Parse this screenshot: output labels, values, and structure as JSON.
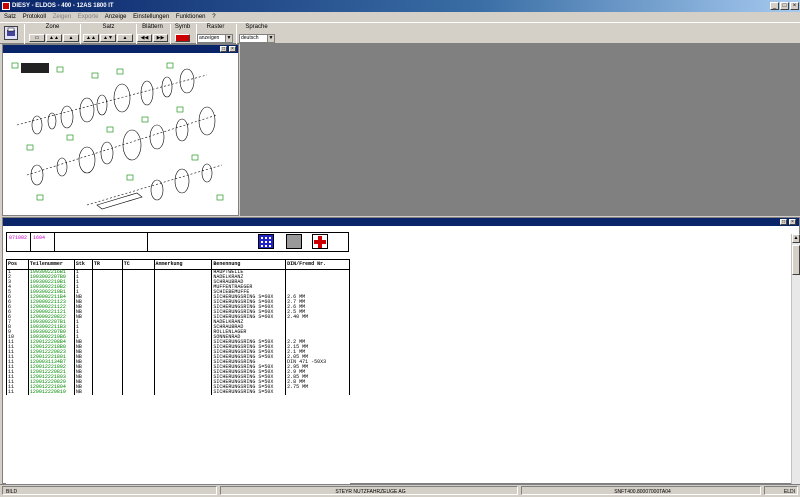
{
  "titlebar": {
    "title": "DIESY - ELDOS - 400 - 12AS 1800 IT"
  },
  "menu": [
    {
      "label": "Satz",
      "disabled": false
    },
    {
      "label": "Protokoll",
      "disabled": false
    },
    {
      "label": "Zeigen",
      "disabled": true
    },
    {
      "label": "Exporte",
      "disabled": true
    },
    {
      "label": "Anzeige",
      "disabled": false
    },
    {
      "label": "Einstellungen",
      "disabled": false
    },
    {
      "label": "Funktionen",
      "disabled": false
    },
    {
      "label": "?",
      "disabled": false
    }
  ],
  "toolbar": {
    "zone": "Zone",
    "satz": "Satz",
    "blaettern": "Blättern",
    "symb": "Symb",
    "raster": "Raster",
    "sprache": "Sprache",
    "raster_value": "anzeigen",
    "sprache_value": "deutsch"
  },
  "info": {
    "left": "071002",
    "mid": "1604"
  },
  "table": {
    "headers": [
      "Pos",
      "Teilenummer",
      "Stk",
      "TR",
      "TC",
      "Anmerkung",
      "Benennung",
      "DIN/Fremd Nr."
    ],
    "rows": [
      [
        "1",
        "1093002216B1",
        "1",
        "",
        "",
        "",
        "HAUPTWELLE",
        ""
      ],
      [
        "2",
        "1093002207B0",
        "1",
        "",
        "",
        "",
        "NADELKRANZ",
        ""
      ],
      [
        "3",
        "1093002210B1",
        "1",
        "",
        "",
        "",
        "SCHRAUBRAD",
        ""
      ],
      [
        "4",
        "1093002210B2",
        "1",
        "",
        "",
        "",
        "MUFFENTRAEGER",
        ""
      ],
      [
        "5",
        "1093002210B1",
        "1",
        "",
        "",
        "",
        "SCHIEBEMUFFE",
        ""
      ],
      [
        "6",
        "1290002211B4",
        "NB",
        "",
        "",
        "",
        "SICHERUNGSRING S=60X",
        "2.6 MM"
      ],
      [
        "6",
        "129000221123",
        "NB",
        "",
        "",
        "",
        "SICHERUNGSRING S=60X",
        "2.7 MM"
      ],
      [
        "6",
        "129000221122",
        "NB",
        "",
        "",
        "",
        "SICHERUNGSRING S=60X",
        "2.6 MM"
      ],
      [
        "6",
        "129000221121",
        "NB",
        "",
        "",
        "",
        "SICHERUNGSRING S=60X",
        "2.5 MM"
      ],
      [
        "6",
        "129000220822",
        "NB",
        "",
        "",
        "",
        "SICHERUNGSRING S=60X",
        "2.40 MM"
      ],
      [
        "7",
        "1093002207B1",
        "1",
        "",
        "",
        "",
        "NADELKRANZ",
        ""
      ],
      [
        "8",
        "1093002211B3",
        "1",
        "",
        "",
        "",
        "SCHRAUBRAD",
        ""
      ],
      [
        "9",
        "1093002207B0",
        "1",
        "",
        "",
        "",
        "ROLLENLAGER",
        ""
      ],
      [
        "10",
        "1093002210B6",
        "1",
        "",
        "",
        "",
        "SONNENRAD",
        ""
      ],
      [
        "11",
        "1290122208B4",
        "NB",
        "",
        "",
        "",
        "SICHERUNGSRING S=50X",
        "2.2 MM"
      ],
      [
        "11",
        "1290122218B0",
        "NB",
        "",
        "",
        "",
        "SICHERUNGSRING S=50X",
        "2.15 MM"
      ],
      [
        "11",
        "129012220823",
        "NB",
        "",
        "",
        "",
        "SICHERUNGSRING S=50X",
        "2.1 MM"
      ],
      [
        "11",
        "129012221801",
        "NB",
        "",
        "",
        "",
        "SICHERUNGSRING S=50X",
        "2.05 MM"
      ],
      [
        "11",
        "1290031134B7",
        "NB",
        "",
        "",
        "",
        "SICHERUNGSRING",
        "DIN 471 -50X3"
      ],
      [
        "11",
        "129012221802",
        "NB",
        "",
        "",
        "",
        "SICHERUNGSRING S=50X",
        "2.95 MM"
      ],
      [
        "11",
        "129012220821",
        "NB",
        "",
        "",
        "",
        "SICHERUNGSRING S=50X",
        "2.9 MM"
      ],
      [
        "11",
        "129012221803",
        "NB",
        "",
        "",
        "",
        "SICHERUNGSRING S=50X",
        "2.85 MM"
      ],
      [
        "11",
        "129012220820",
        "NB",
        "",
        "",
        "",
        "SICHERUNGSRING S=50X",
        "2.8 MM"
      ],
      [
        "11",
        "129012221804",
        "NB",
        "",
        "",
        "",
        "SICHERUNGSRING S=50X",
        "2.75 MM"
      ],
      [
        "11",
        "129012220819",
        "NB",
        "",
        "",
        "",
        "SICHERUNGSRING S=50X",
        ""
      ]
    ]
  },
  "status": {
    "left": "BILD",
    "center": "STEYR NUTZFAHRZEUGE AG",
    "right": "SNFT400.80007000TA04",
    "last": "ELDI"
  }
}
